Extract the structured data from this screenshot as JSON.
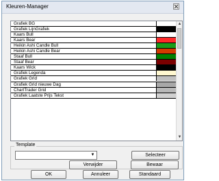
{
  "window": {
    "title": "Kleuren-Manager"
  },
  "list": {
    "items": [
      {
        "label": "Grafiek BG",
        "color": "#ffffff"
      },
      {
        "label": "Grafiek LijnGrafiek",
        "color": "#000000"
      },
      {
        "label": "Kaars Bull",
        "color": "#ffffff"
      },
      {
        "label": "Kaars Bear",
        "color": "#ff2a2a"
      },
      {
        "label": "Heikin Ashi Candle Bull",
        "color": "#1a9e1a"
      },
      {
        "label": "Heikin Ashi Candle Bear",
        "color": "#d23a00"
      },
      {
        "label": "Staaf Bull",
        "color": "#008000"
      },
      {
        "label": "Staaf Bear",
        "color": "#7a0000"
      },
      {
        "label": "Kaars Wick",
        "color": "#000000"
      },
      {
        "label": "Grafiek Legenda",
        "color": "#fff8d0"
      },
      {
        "label": "Grafiek Grid",
        "color": "#c0c0c0"
      },
      {
        "label": "Grafiek Grid nieuwe Dag",
        "color": "#a8a8a8"
      },
      {
        "label": "ChartTrader Grid",
        "color": "#b8b8b8"
      },
      {
        "label": "Grafiek Laatste Prijs Tekst",
        "color": "#d0d0d0"
      }
    ]
  },
  "template": {
    "group_label": "Template",
    "selected_value": "",
    "selecteer_label": "Selecteer",
    "verwijder_label": "Verwijder",
    "bewaar_label": "Bewaar"
  },
  "footer": {
    "ok_label": "OK",
    "annuleer_label": "Annuleer",
    "standaard_label": "Standaard"
  }
}
